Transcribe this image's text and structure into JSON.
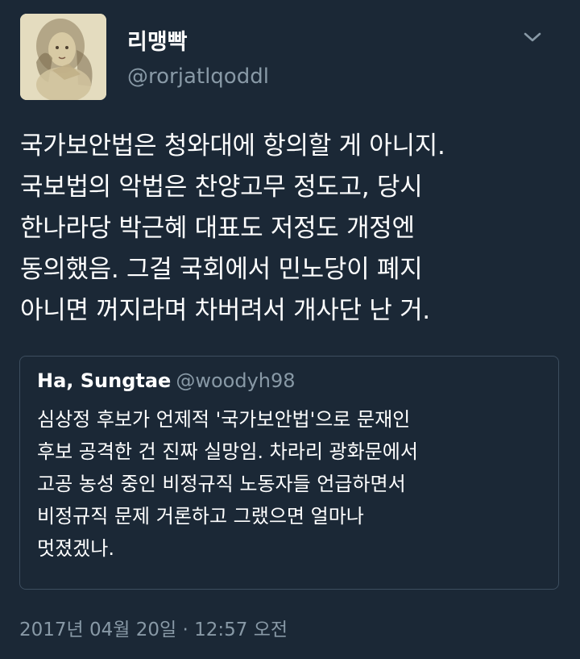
{
  "tweet": {
    "author": {
      "display_name": "리맹빡",
      "handle": "@rorjatlqoddl"
    },
    "text_lines": [
      "국가보안법은 청와대에 항의할 게 아니지.",
      "국보법의 악법은 찬양고무 정도고, 당시",
      "한나라당 박근혜 대표도 저정도 개정엔",
      "동의했음. 그걸 국회에서 민노당이 폐지",
      "아니면 꺼지라며 차버려서 개사단 난 거."
    ],
    "timestamp": "2017년 04월 20일 · 12:57 오전"
  },
  "quoted_tweet": {
    "author": {
      "display_name": "Ha, Sungtae",
      "handle": "@woodyh98"
    },
    "text_lines": [
      "심상정 후보가 언제적 '국가보안법'으로 문재인",
      "후보 공격한 건 진짜 실망임. 차라리 광화문에서",
      "고공 농성 중인 비정규직 노동자들 언급하면서",
      "비정규직 문제 거론하고 그랬으면 얼마나",
      "멋졌겠나."
    ]
  },
  "icons": {
    "menu": "chevron-down-icon",
    "avatar": "profile-avatar"
  },
  "colors": {
    "background": "#1b2836",
    "primary_text": "#ffffff",
    "secondary_text": "#8899a6",
    "card_border": "#3d4e5f"
  }
}
